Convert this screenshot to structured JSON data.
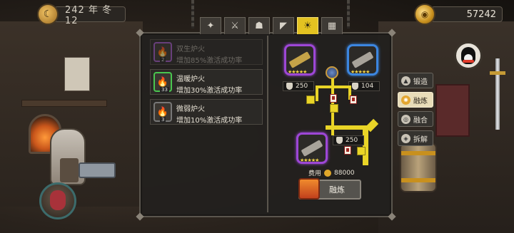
{
  "hud": {
    "date": "242 年 冬 12",
    "gold": "57242"
  },
  "icons": {
    "season": "moon-icon",
    "coin": "coin-icon",
    "qq": "penguin-icon"
  },
  "tabs": [
    {
      "icon": "✦",
      "name": "tab-1"
    },
    {
      "icon": "⚔",
      "name": "tab-2"
    },
    {
      "icon": "☗",
      "name": "tab-3"
    },
    {
      "icon": "◤",
      "name": "tab-4"
    },
    {
      "icon": "☀",
      "name": "tab-5"
    },
    {
      "icon": "▦",
      "name": "tab-6"
    }
  ],
  "furnace_list": [
    {
      "name": "双生炉火",
      "desc": "增加85%激活成功率",
      "level": "2",
      "rarity": "purple"
    },
    {
      "name": "温暖炉火",
      "desc": "增加30%激活成功率",
      "level": "33",
      "rarity": "green"
    },
    {
      "name": "微弱炉火",
      "desc": "增加10%激活成功率",
      "level": "3",
      "rarity": "grey"
    }
  ],
  "fusion": {
    "left_value": "250",
    "right_value": "104",
    "result_value": "250",
    "stars": "★★★★★",
    "cost_label": "费用",
    "cost_value": "88000",
    "button_label": "融炼"
  },
  "side_nav": [
    {
      "label": "锻造",
      "active": false
    },
    {
      "label": "融炼",
      "active": true
    },
    {
      "label": "融合",
      "active": false
    },
    {
      "label": "拆解",
      "active": false
    }
  ]
}
